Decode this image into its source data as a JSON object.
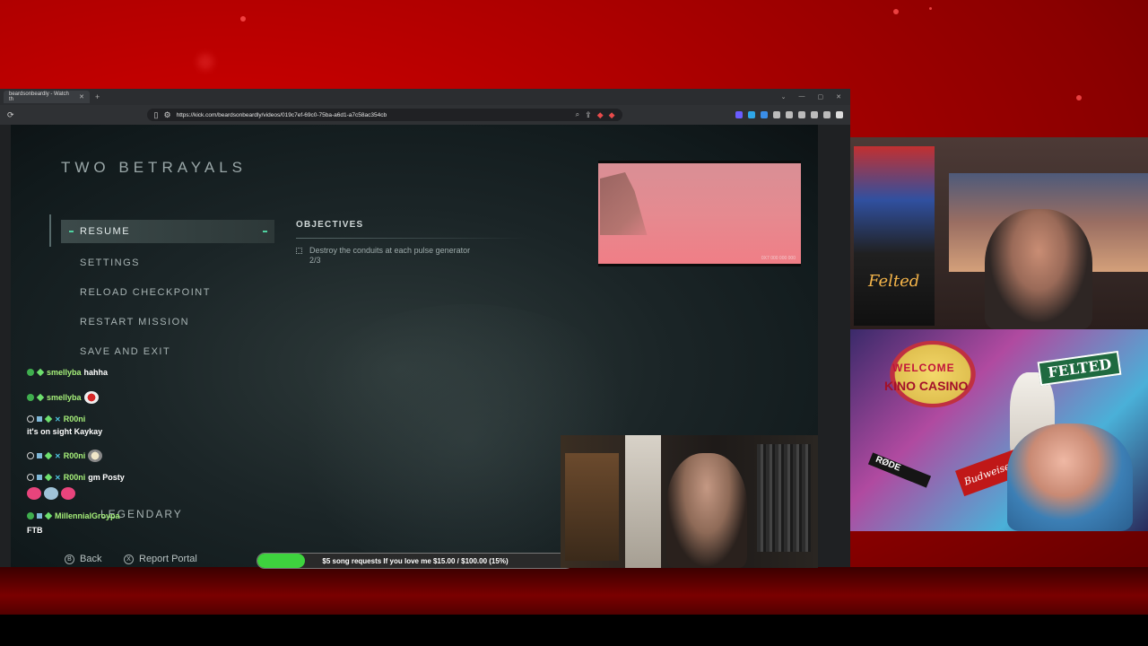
{
  "browser": {
    "tab_title": "beardsonbeardly - Watch th",
    "url": "https://kick.com/beardsonbeardly/videos/019c7ef-69c0-75ba-a6d1-a7c58ac354cb"
  },
  "game": {
    "mission_title": "TWO BETRAYALS",
    "menu_items": [
      {
        "label": "RESUME",
        "active": true
      },
      {
        "label": "SETTINGS"
      },
      {
        "label": "RELOAD CHECKPOINT"
      },
      {
        "label": "RESTART MISSION"
      },
      {
        "label": "SAVE AND EXIT"
      }
    ],
    "legendary_label": "LEGENDARY",
    "objectives_title": "OBJECTIVES",
    "objective_text": "Destroy the conduits at each pulse generator 2/3",
    "preview_code": "0X7 000 000 000",
    "footer": {
      "back_glyph": "B",
      "back_label": "Back",
      "report_glyph": "X",
      "report_label": "Report Portal"
    }
  },
  "chat": {
    "messages": [
      {
        "user": "smellyba",
        "text": "hahha"
      },
      {
        "user": "smellyba",
        "text": ""
      },
      {
        "user": "R00ni",
        "text": ""
      },
      {
        "text_line": "it's on sight Kaykay"
      },
      {
        "user": "R00ni",
        "text": ""
      },
      {
        "user": "R00ni",
        "text": "gm Posty"
      },
      {
        "user": "MillennialGroypa",
        "text": ""
      },
      {
        "text_line": "FTB"
      }
    ]
  },
  "donation_goal": {
    "label": "$5 song requests If you love me $15.00 / $100.00 (15%)",
    "progress_fraction": 0.15,
    "color": "#3ed33e"
  },
  "webcams": {
    "top_sign": "Felted",
    "bottom_welcome": "WELCOME",
    "bottom_casino": "KINO CASINO",
    "bottom_felted": "FELTED",
    "bottom_mic": "RØDE",
    "bottom_beer": "Budweiser"
  },
  "colors": {
    "background_red": "#b00000",
    "menu_accent": "#4fd2a0",
    "chat_user": "#a6f07a"
  }
}
